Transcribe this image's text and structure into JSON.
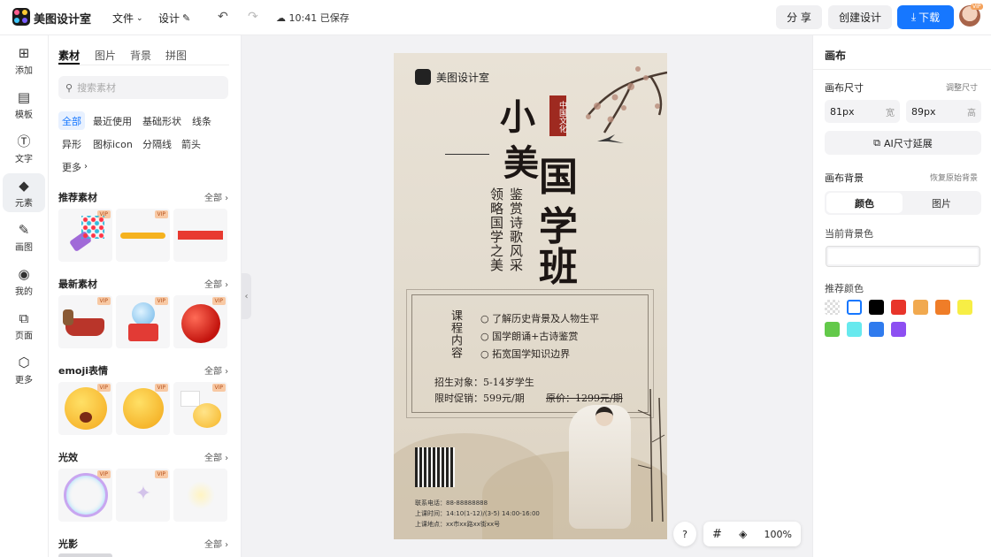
{
  "app": {
    "name": "美图设计室"
  },
  "topbar": {
    "file_menu": "文件",
    "design_menu": "设计",
    "saved_status": "10:41 已保存",
    "share_label": "分 享",
    "create_label": "创建设计",
    "download_label": "下载",
    "vip_badge": "VIP"
  },
  "rail": {
    "items": [
      {
        "label": "添加",
        "icon": "plus-square-icon"
      },
      {
        "label": "模板",
        "icon": "layout-icon"
      },
      {
        "label": "文字",
        "icon": "text-icon"
      },
      {
        "label": "元素",
        "icon": "shapes-icon"
      },
      {
        "label": "画图",
        "icon": "pen-icon"
      },
      {
        "label": "我的",
        "icon": "user-icon"
      },
      {
        "label": "页面",
        "icon": "add-page-icon"
      },
      {
        "label": "更多",
        "icon": "cube-icon"
      }
    ],
    "active_index": 3
  },
  "panel": {
    "tabs": [
      "素材",
      "图片",
      "背景",
      "拼图"
    ],
    "search_placeholder": "搜索素材",
    "chips": [
      "全部",
      "最近使用",
      "基础形状",
      "线条",
      "异形",
      "图标icon",
      "分隔线",
      "箭头",
      "更多"
    ],
    "sections": [
      {
        "title": "推荐素材",
        "all": "全部"
      },
      {
        "title": "最新素材",
        "all": "全部"
      },
      {
        "title": "emoji表情",
        "all": "全部"
      },
      {
        "title": "光效",
        "all": "全部"
      },
      {
        "title": "光影",
        "all": "全部"
      }
    ],
    "vip_label": "VIP"
  },
  "poster": {
    "brand": "美图设计室",
    "title_a": "小",
    "title_b": "美",
    "title_c": "国",
    "title_d": "学",
    "title_e": "班",
    "seal": "中国文化",
    "vert_1": "鉴赏诗歌风采",
    "vert_2": "领略国学之美",
    "course_label": "课程内容",
    "course_items": [
      "了解历史背景及人物生平",
      "国学朗诵+古诗鉴赏",
      "拓宽国学知识边界"
    ],
    "audience": "招生对象：5-14岁学生",
    "promo_price": "限时促销：599元/期",
    "original_price": "原价：1299元/期",
    "contact_1": "联系电话：88-88888888",
    "contact_2": "上课时间：14:10(1-12)/(3-5) 14:00-16:00",
    "contact_3": "上课地点：xx市xx路xx街xx号"
  },
  "canvas_tools": {
    "help": "?",
    "zoom": "100%"
  },
  "right": {
    "title": "画布",
    "size_label": "画布尺寸",
    "adjust_size": "调整尺寸",
    "width_value": "81px",
    "width_unit": "宽",
    "height_value": "89px",
    "height_unit": "高",
    "ai_extend": "AI尺寸延展",
    "bg_label": "画布背景",
    "restore_bg": "恢复原始背景",
    "seg_color": "颜色",
    "seg_image": "图片",
    "current_bg": "当前背景色",
    "recommend": "推荐颜色",
    "swatches": [
      "transparent",
      "#ffffff",
      "#000000",
      "#e8352a",
      "#f1a94f",
      "#ef7d28",
      "#f7ee45",
      "#63c94a",
      "#67e9ee",
      "#2f7bee",
      "#8d4ff2"
    ]
  }
}
